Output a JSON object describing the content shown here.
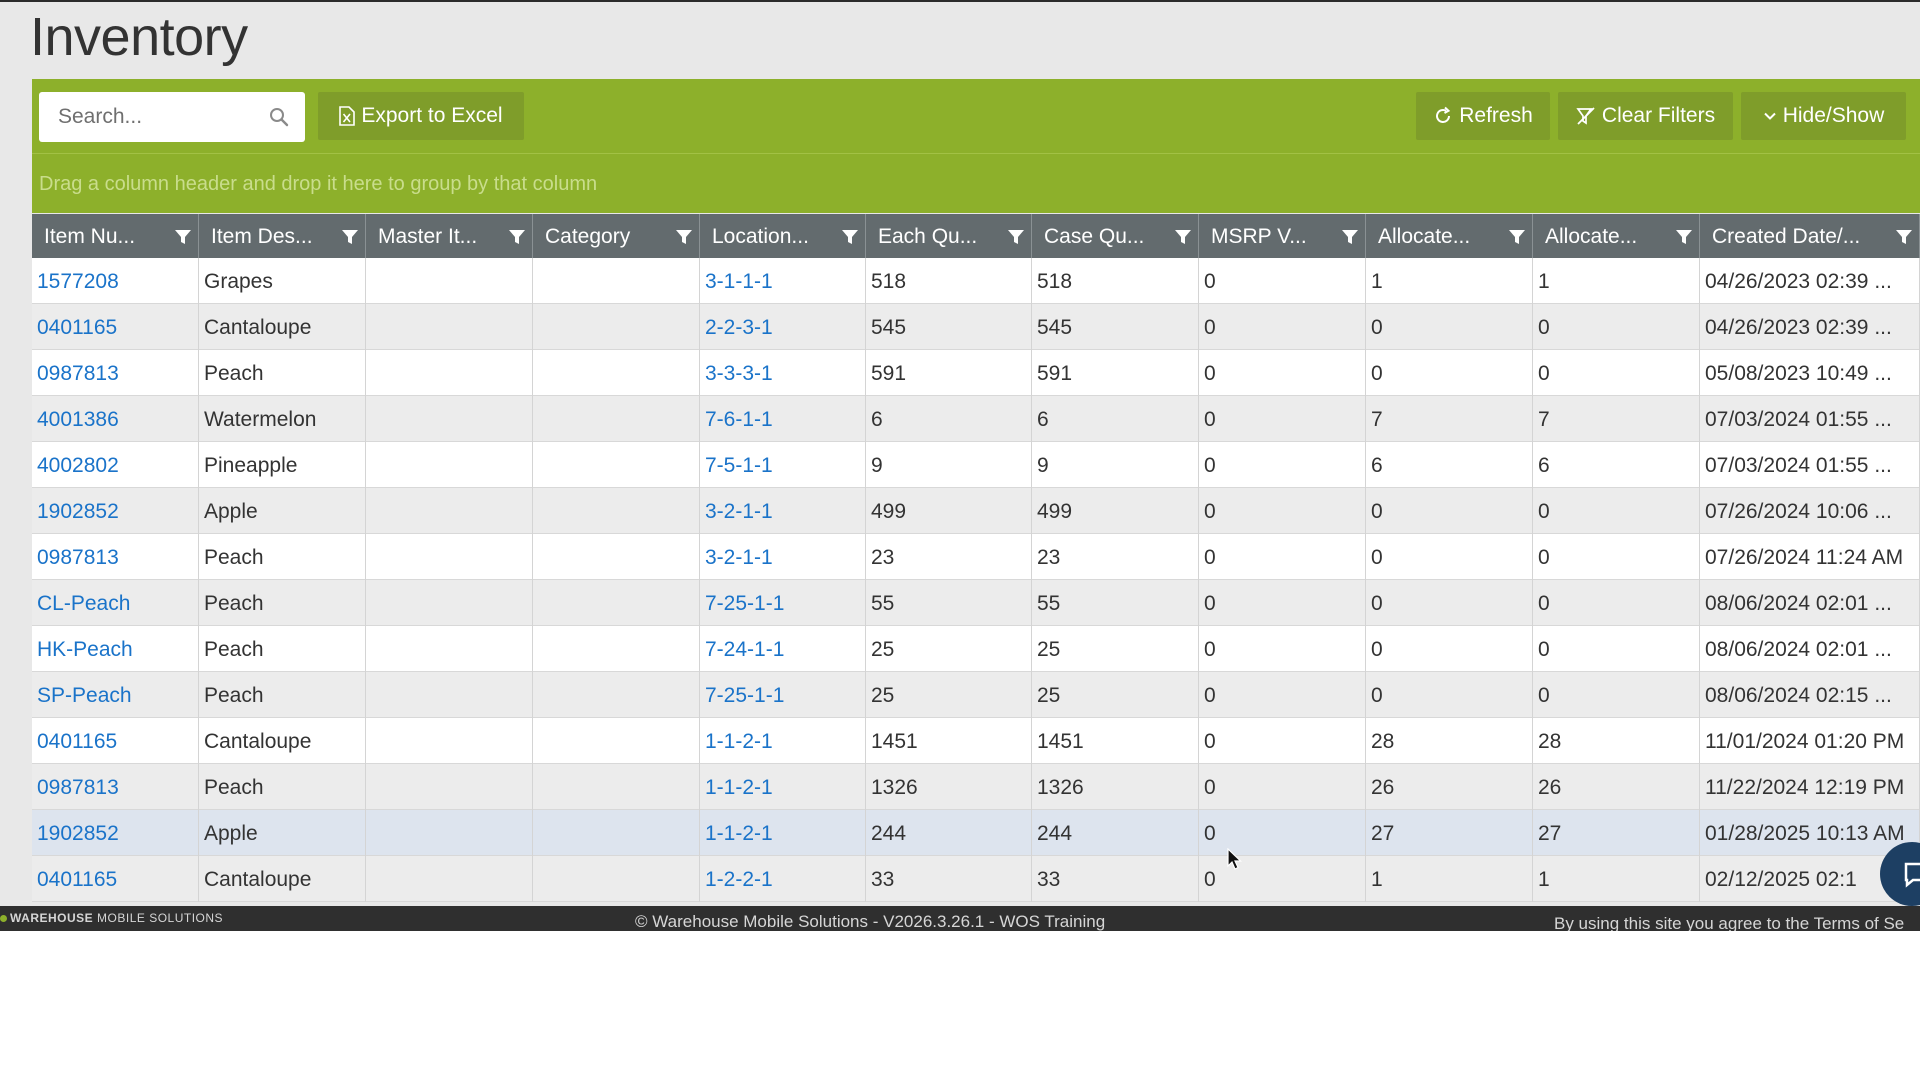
{
  "page": {
    "title": "Inventory"
  },
  "toolbar": {
    "search_placeholder": "Search...",
    "export_label": "Export to Excel",
    "refresh_label": "Refresh",
    "clear_filters_label": "Clear Filters",
    "hide_show_label": "Hide/Show"
  },
  "group_panel": {
    "hint": "Drag a column header and drop it here to group by that column"
  },
  "columns": [
    "Item Nu...",
    "Item Des...",
    "Master It...",
    "Category",
    "Location...",
    "Each Qu...",
    "Case Qu...",
    "MSRP V...",
    "Allocate...",
    "Allocate...",
    "Created Date/..."
  ],
  "rows": [
    [
      "1577208",
      "Grapes",
      "",
      "",
      "3-1-1-1",
      "518",
      "518",
      "0",
      "1",
      "1",
      "04/26/2023 02:39 ..."
    ],
    [
      "0401165",
      "Cantaloupe",
      "",
      "",
      "2-2-3-1",
      "545",
      "545",
      "0",
      "0",
      "0",
      "04/26/2023 02:39 ..."
    ],
    [
      "0987813",
      "Peach",
      "",
      "",
      "3-3-3-1",
      "591",
      "591",
      "0",
      "0",
      "0",
      "05/08/2023 10:49 ..."
    ],
    [
      "4001386",
      "Watermelon",
      "",
      "",
      "7-6-1-1",
      "6",
      "6",
      "0",
      "7",
      "7",
      "07/03/2024 01:55 ..."
    ],
    [
      "4002802",
      "Pineapple",
      "",
      "",
      "7-5-1-1",
      "9",
      "9",
      "0",
      "6",
      "6",
      "07/03/2024 01:55 ..."
    ],
    [
      "1902852",
      "Apple",
      "",
      "",
      "3-2-1-1",
      "499",
      "499",
      "0",
      "0",
      "0",
      "07/26/2024 10:06 ..."
    ],
    [
      "0987813",
      "Peach",
      "",
      "",
      "3-2-1-1",
      "23",
      "23",
      "0",
      "0",
      "0",
      "07/26/2024 11:24 AM"
    ],
    [
      "CL-Peach",
      "Peach",
      "",
      "",
      "7-25-1-1",
      "55",
      "55",
      "0",
      "0",
      "0",
      "08/06/2024 02:01 ..."
    ],
    [
      "HK-Peach",
      "Peach",
      "",
      "",
      "7-24-1-1",
      "25",
      "25",
      "0",
      "0",
      "0",
      "08/06/2024 02:01 ..."
    ],
    [
      "SP-Peach",
      "Peach",
      "",
      "",
      "7-25-1-1",
      "25",
      "25",
      "0",
      "0",
      "0",
      "08/06/2024 02:15 ..."
    ],
    [
      "0401165",
      "Cantaloupe",
      "",
      "",
      "1-1-2-1",
      "1451",
      "1451",
      "0",
      "28",
      "28",
      "11/01/2024 01:20 PM"
    ],
    [
      "0987813",
      "Peach",
      "",
      "",
      "1-1-2-1",
      "1326",
      "1326",
      "0",
      "26",
      "26",
      "11/22/2024 12:19 PM"
    ],
    [
      "1902852",
      "Apple",
      "",
      "",
      "1-1-2-1",
      "244",
      "244",
      "0",
      "27",
      "27",
      "01/28/2025 10:13 AM"
    ],
    [
      "0401165",
      "Cantaloupe",
      "",
      "",
      "1-2-2-1",
      "33",
      "33",
      "0",
      "1",
      "1",
      "02/12/2025 02:1"
    ]
  ],
  "highlighted_row": 12,
  "link_columns": [
    0,
    4
  ],
  "footer": {
    "logo_bold": "WAREHOUSE",
    "logo_rest": "MOBILE SOLUTIONS",
    "copyright": "© Warehouse Mobile Solutions - V2026.3.26.1 - WOS Training",
    "terms": "By using this site you agree to the Terms of Se"
  },
  "colors": {
    "toolbar_green": "#8db02b",
    "button_green": "#7f9d2a",
    "header_gray": "#636b6e",
    "link_blue": "#1a73c9",
    "footer_dark": "#2f2f2f"
  },
  "icons": {
    "search": "search-icon",
    "export": "excel-icon",
    "refresh": "refresh-icon",
    "clear_filters": "clear-filter-icon",
    "hide_show": "chevron-down-icon",
    "column_filter": "funnel-icon",
    "chat": "chat-icon"
  }
}
